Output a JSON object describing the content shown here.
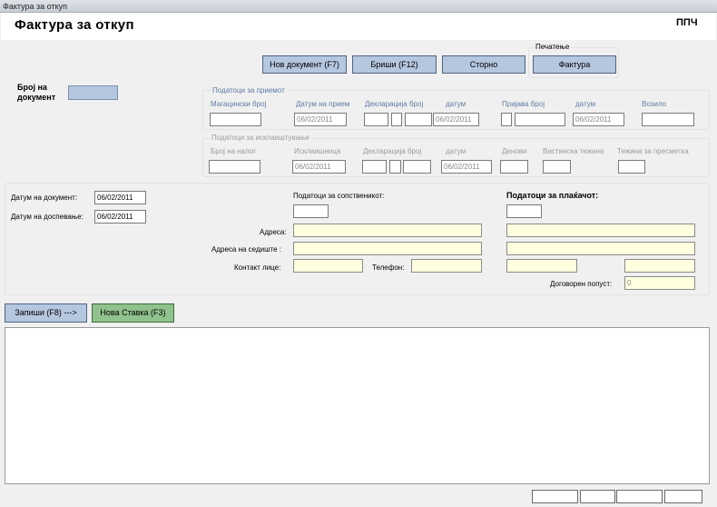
{
  "window": {
    "title": "Фактура за откуп"
  },
  "header": {
    "title": "Фактура за откуп",
    "code": "ППЧ"
  },
  "toolbar": {
    "new_doc": "Нов документ (F7)",
    "delete": "Бриши (F12)",
    "storno": "Сторно",
    "print_group": "Печатење",
    "invoice": "Фактура"
  },
  "doc_number": {
    "label": "Број на документ",
    "value": ""
  },
  "receipt": {
    "group": "Податоци за приемот",
    "warehouse_no": "Магацински број",
    "receipt_date_label": "Датум на прием",
    "receipt_date": "06/02/2011",
    "declaration_no": "Декларација број",
    "date_label": "датум",
    "date": "06/02/2011",
    "application_no": "Пријава број",
    "date2_label": "датум",
    "date2": "06/02/2011",
    "driver": "Возило"
  },
  "unloading": {
    "group": "Податоци за исклаиштување",
    "order_no": "Број на налог",
    "unloading_label": "Исклаишница",
    "unloading_date": "06/02/2011",
    "declaration_no": "Декларација број",
    "date_label": "датум",
    "date": "06/02/2011",
    "days": "Денови",
    "actual_weight": "Вистинска тежина",
    "payment_weight": "Тежина за пресметка"
  },
  "doc_dates": {
    "doc_date_label": "Датум на документ:",
    "doc_date": "06/02/2011",
    "due_date_label": "Датум на доспевање:",
    "due_date": "06/02/2011"
  },
  "owner": {
    "title": "Податоци за сопственикот:",
    "address": "Адреса:",
    "hq_address": "Адреса на седиште :",
    "contact": "Контакт лице:",
    "phone": "Телефон:"
  },
  "payer": {
    "title": "Податоци за плаќачот:",
    "discount_label": "Договорен попуст:",
    "discount": "0"
  },
  "actions": {
    "save": "Запиши (F8) --->",
    "new_item": "Нова Ставка (F3)"
  }
}
